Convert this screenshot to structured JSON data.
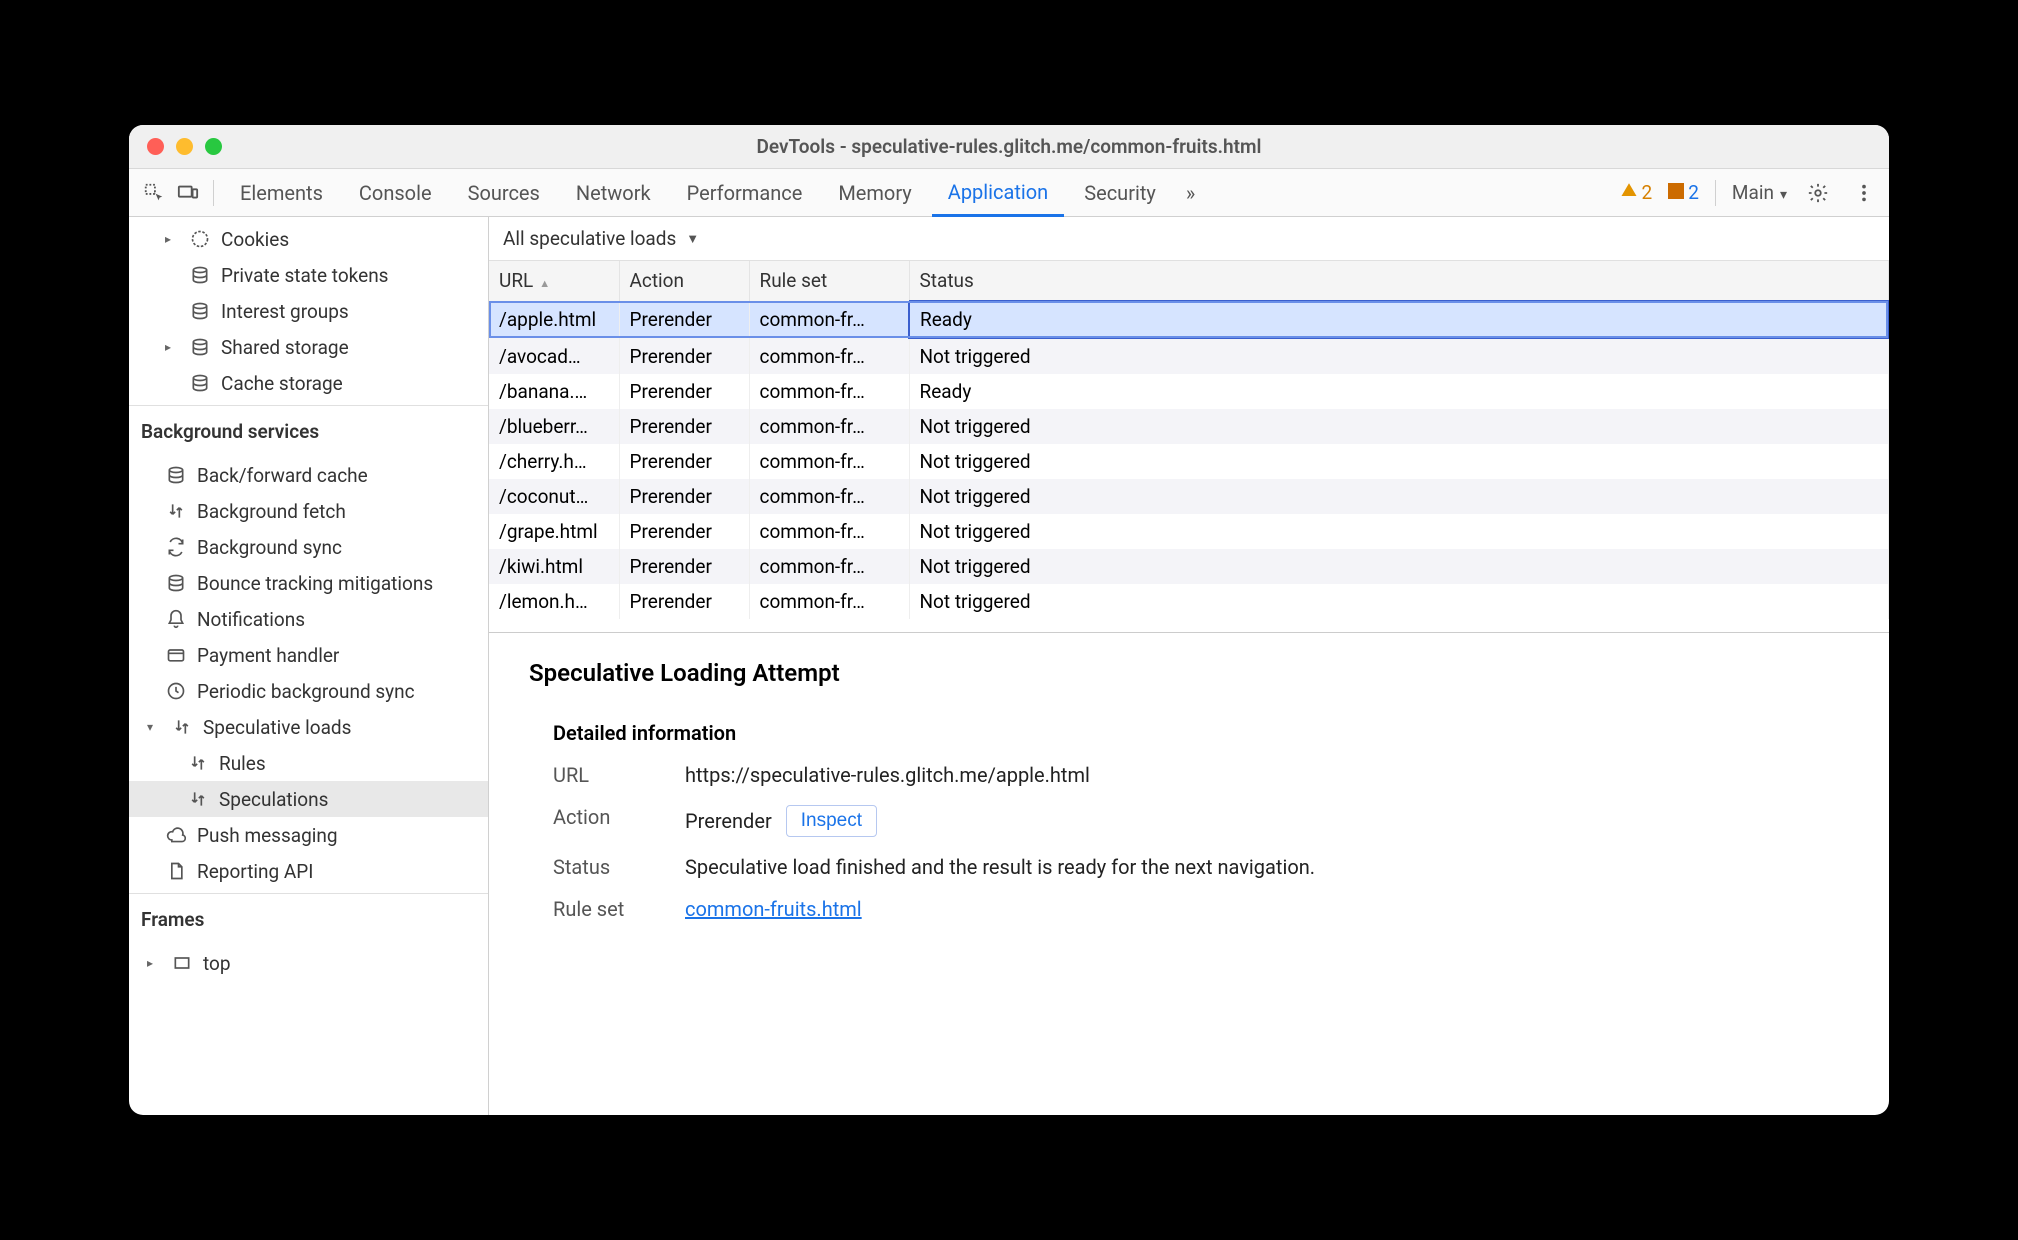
{
  "window_title": "DevTools - speculative-rules.glitch.me/common-fruits.html",
  "tabs": [
    "Elements",
    "Console",
    "Sources",
    "Network",
    "Performance",
    "Memory",
    "Application",
    "Security"
  ],
  "active_tab": "Application",
  "overflow_glyph": "»",
  "warn_count": "2",
  "issue_count": "2",
  "context_label": "Main",
  "sidebar_top": {
    "cookies": "Cookies",
    "private_state_tokens": "Private state tokens",
    "interest_groups": "Interest groups",
    "shared_storage": "Shared storage",
    "cache_storage": "Cache storage"
  },
  "bg_header": "Background services",
  "bg": {
    "back_forward_cache": "Back/forward cache",
    "background_fetch": "Background fetch",
    "background_sync": "Background sync",
    "bounce_tracking": "Bounce tracking mitigations",
    "notifications": "Notifications",
    "payment_handler": "Payment handler",
    "periodic_bg_sync": "Periodic background sync",
    "speculative_loads": "Speculative loads",
    "rules": "Rules",
    "speculations": "Speculations",
    "push_messaging": "Push messaging",
    "reporting_api": "Reporting API"
  },
  "frames_header": "Frames",
  "frames_top": "top",
  "filter_label": "All speculative loads",
  "columns": {
    "url": "URL",
    "action": "Action",
    "ruleset": "Rule set",
    "status": "Status"
  },
  "rows": [
    {
      "url": "/apple.html",
      "action": "Prerender",
      "ruleset": "common-fr…",
      "status": "Ready"
    },
    {
      "url": "/avocad…",
      "action": "Prerender",
      "ruleset": "common-fr…",
      "status": "Not triggered"
    },
    {
      "url": "/banana.…",
      "action": "Prerender",
      "ruleset": "common-fr…",
      "status": "Ready"
    },
    {
      "url": "/blueberr…",
      "action": "Prerender",
      "ruleset": "common-fr…",
      "status": "Not triggered"
    },
    {
      "url": "/cherry.h…",
      "action": "Prerender",
      "ruleset": "common-fr…",
      "status": "Not triggered"
    },
    {
      "url": "/coconut…",
      "action": "Prerender",
      "ruleset": "common-fr…",
      "status": "Not triggered"
    },
    {
      "url": "/grape.html",
      "action": "Prerender",
      "ruleset": "common-fr…",
      "status": "Not triggered"
    },
    {
      "url": "/kiwi.html",
      "action": "Prerender",
      "ruleset": "common-fr…",
      "status": "Not triggered"
    },
    {
      "url": "/lemon.h…",
      "action": "Prerender",
      "ruleset": "common-fr…",
      "status": "Not triggered"
    }
  ],
  "detail": {
    "heading": "Speculative Loading Attempt",
    "sub": "Detailed information",
    "url_k": "URL",
    "url_v": "https://speculative-rules.glitch.me/apple.html",
    "action_k": "Action",
    "action_v": "Prerender",
    "inspect": "Inspect",
    "status_k": "Status",
    "status_v": "Speculative load finished and the result is ready for the next navigation.",
    "ruleset_k": "Rule set",
    "ruleset_v": "common-fruits.html"
  }
}
